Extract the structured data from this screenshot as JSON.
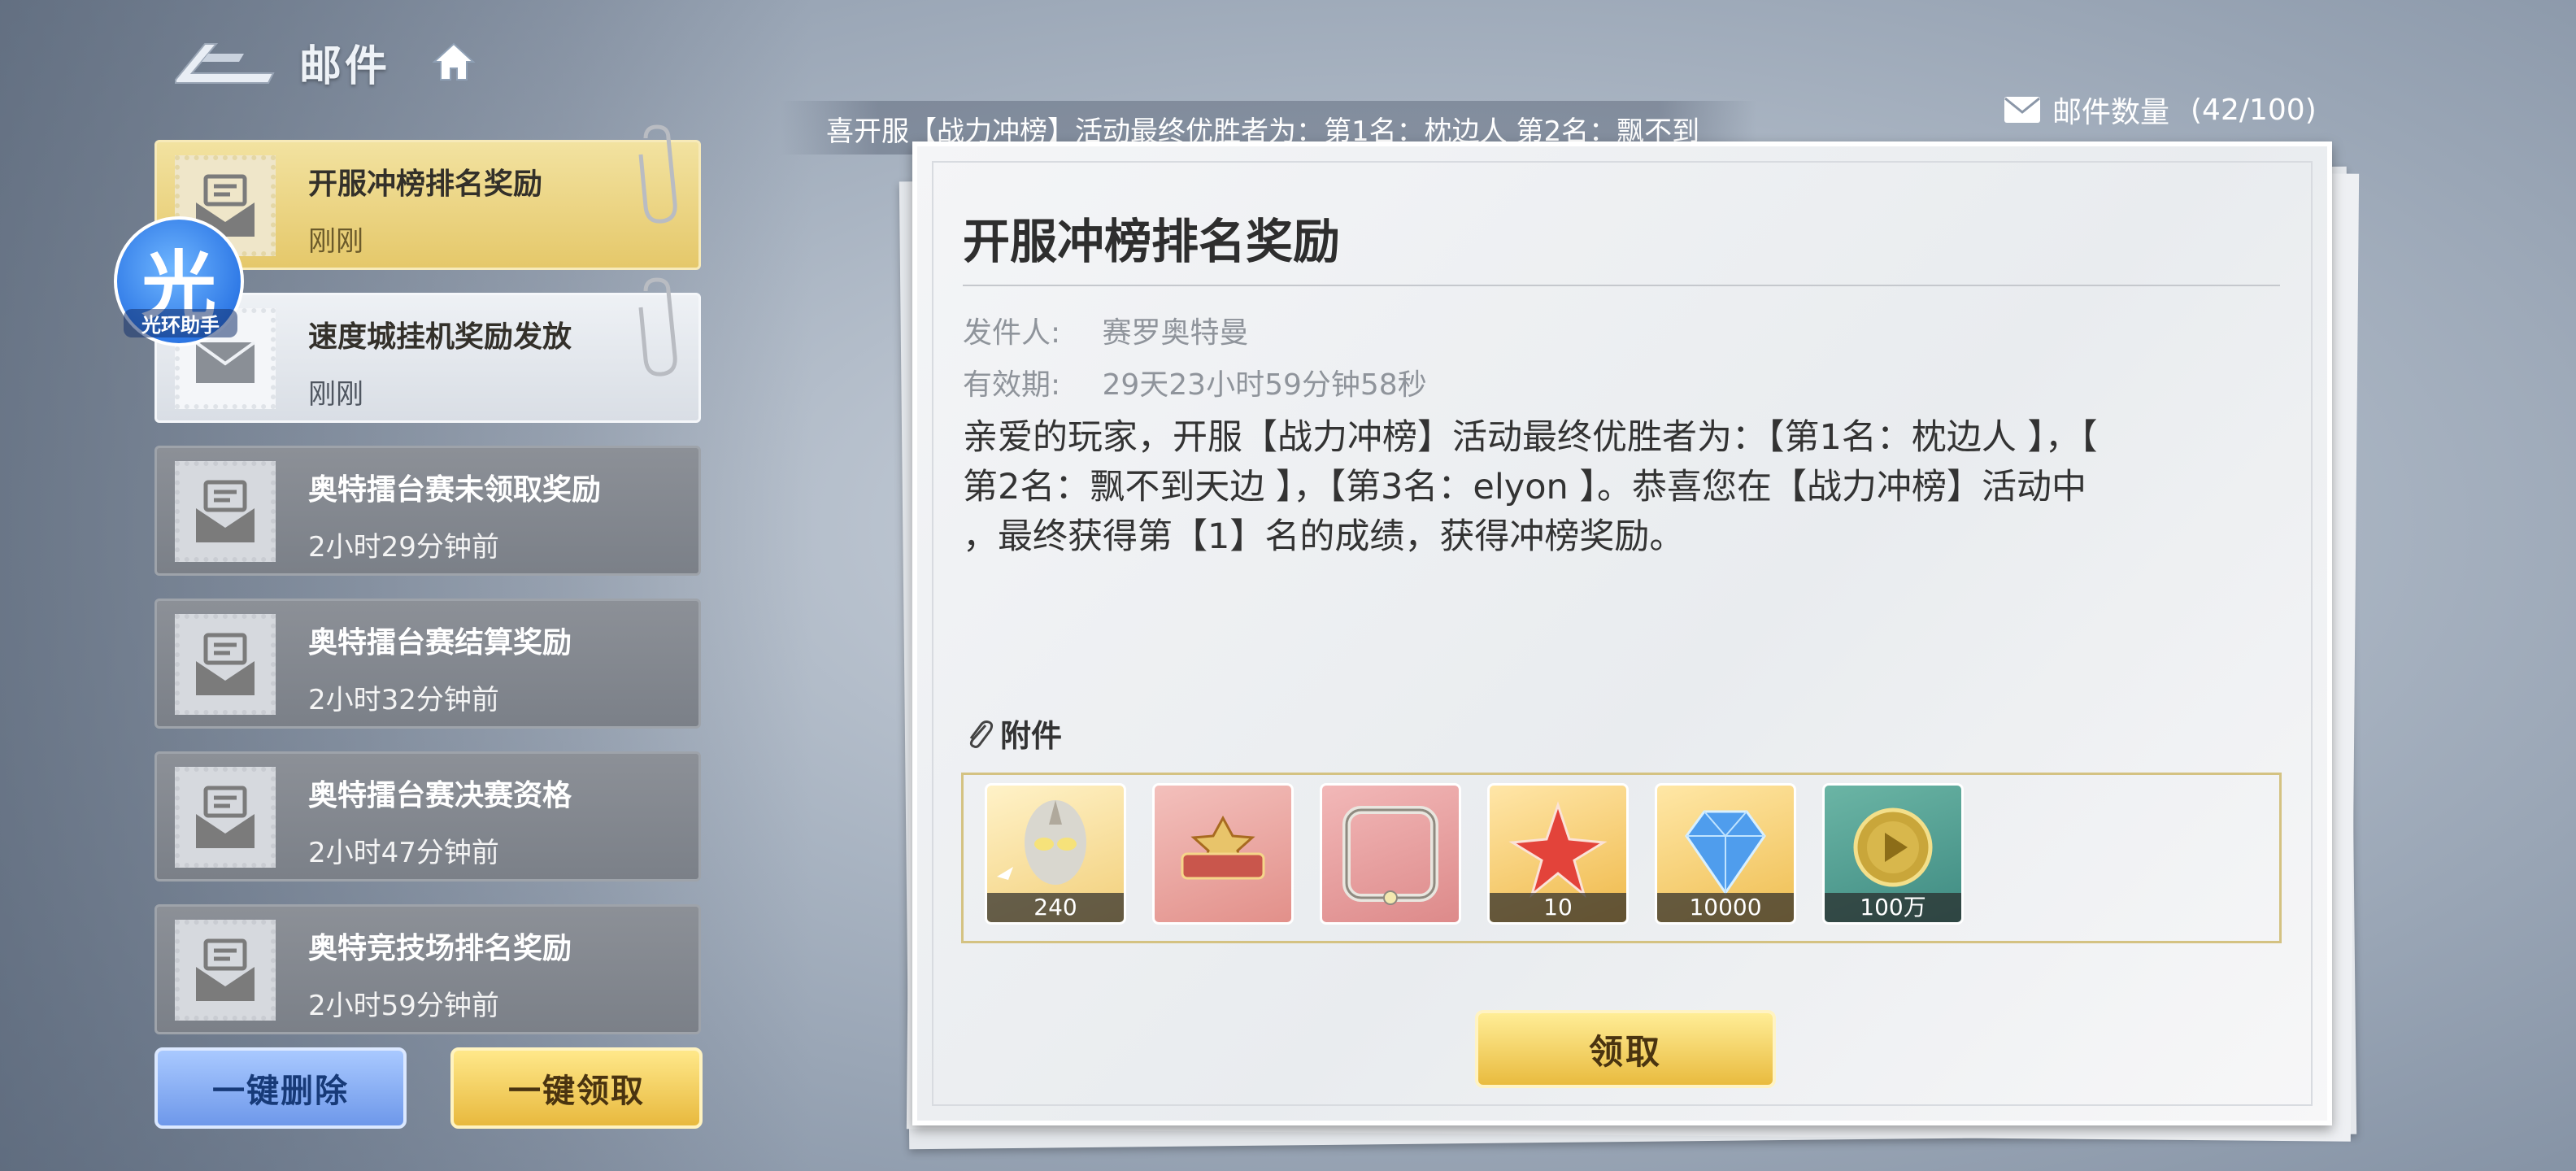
{
  "header": {
    "title": "邮件"
  },
  "marquee": {
    "text": "喜开服【战力冲榜】活动最终优胜者为：第1名：枕边人 第2名：飘不到"
  },
  "mail_count": {
    "label": "邮件数量",
    "value": "(42/100)"
  },
  "mail_list": [
    {
      "title": "开服冲榜排名奖励",
      "time": "刚刚",
      "state": "selected"
    },
    {
      "title": "速度城挂机奖励发放",
      "time": "刚刚",
      "state": "unread"
    },
    {
      "title": "奥特擂台赛未领取奖励",
      "time": "2小时29分钟前",
      "state": "read"
    },
    {
      "title": "奥特擂台赛结算奖励",
      "time": "2小时32分钟前",
      "state": "read"
    },
    {
      "title": "奥特擂台赛决赛资格",
      "time": "2小时47分钟前",
      "state": "read"
    },
    {
      "title": "奥特竞技场排名奖励",
      "time": "2小时59分钟前",
      "state": "read"
    }
  ],
  "helper": {
    "glyph": "光",
    "label": "光环助手"
  },
  "buttons": {
    "delete_all": "一键删除",
    "claim_all": "一键领取",
    "claim": "领取"
  },
  "letter": {
    "title": "开服冲榜排名奖励",
    "sender_label": "发件人:",
    "sender": "赛罗奥特曼",
    "validity_label": "有效期:",
    "validity": "29天23小时59分钟58秒",
    "body_lines": [
      "亲爱的玩家，开服【战力冲榜】活动最终优胜者为：【第1名：枕边人 】，【",
      "第2名：飘不到天边 】，【第3名：elyon 】。恭喜您在【战力冲榜】活动中",
      "，最终获得第【1】名的成绩，获得冲榜奖励。"
    ],
    "attachment_label": "附件"
  },
  "attachments": [
    {
      "icon": "ultraman-shard-icon",
      "count": "240"
    },
    {
      "icon": "title-badge-icon",
      "count": ""
    },
    {
      "icon": "avatar-frame-icon",
      "count": ""
    },
    {
      "icon": "red-star-icon",
      "count": "10"
    },
    {
      "icon": "blue-diamond-icon",
      "count": "10000"
    },
    {
      "icon": "gold-coin-icon",
      "count": "100万"
    }
  ],
  "colors": {
    "gold": "#e9bb3f",
    "blue_button": "#6e98ea",
    "selected_mail": "#e5c86a"
  }
}
